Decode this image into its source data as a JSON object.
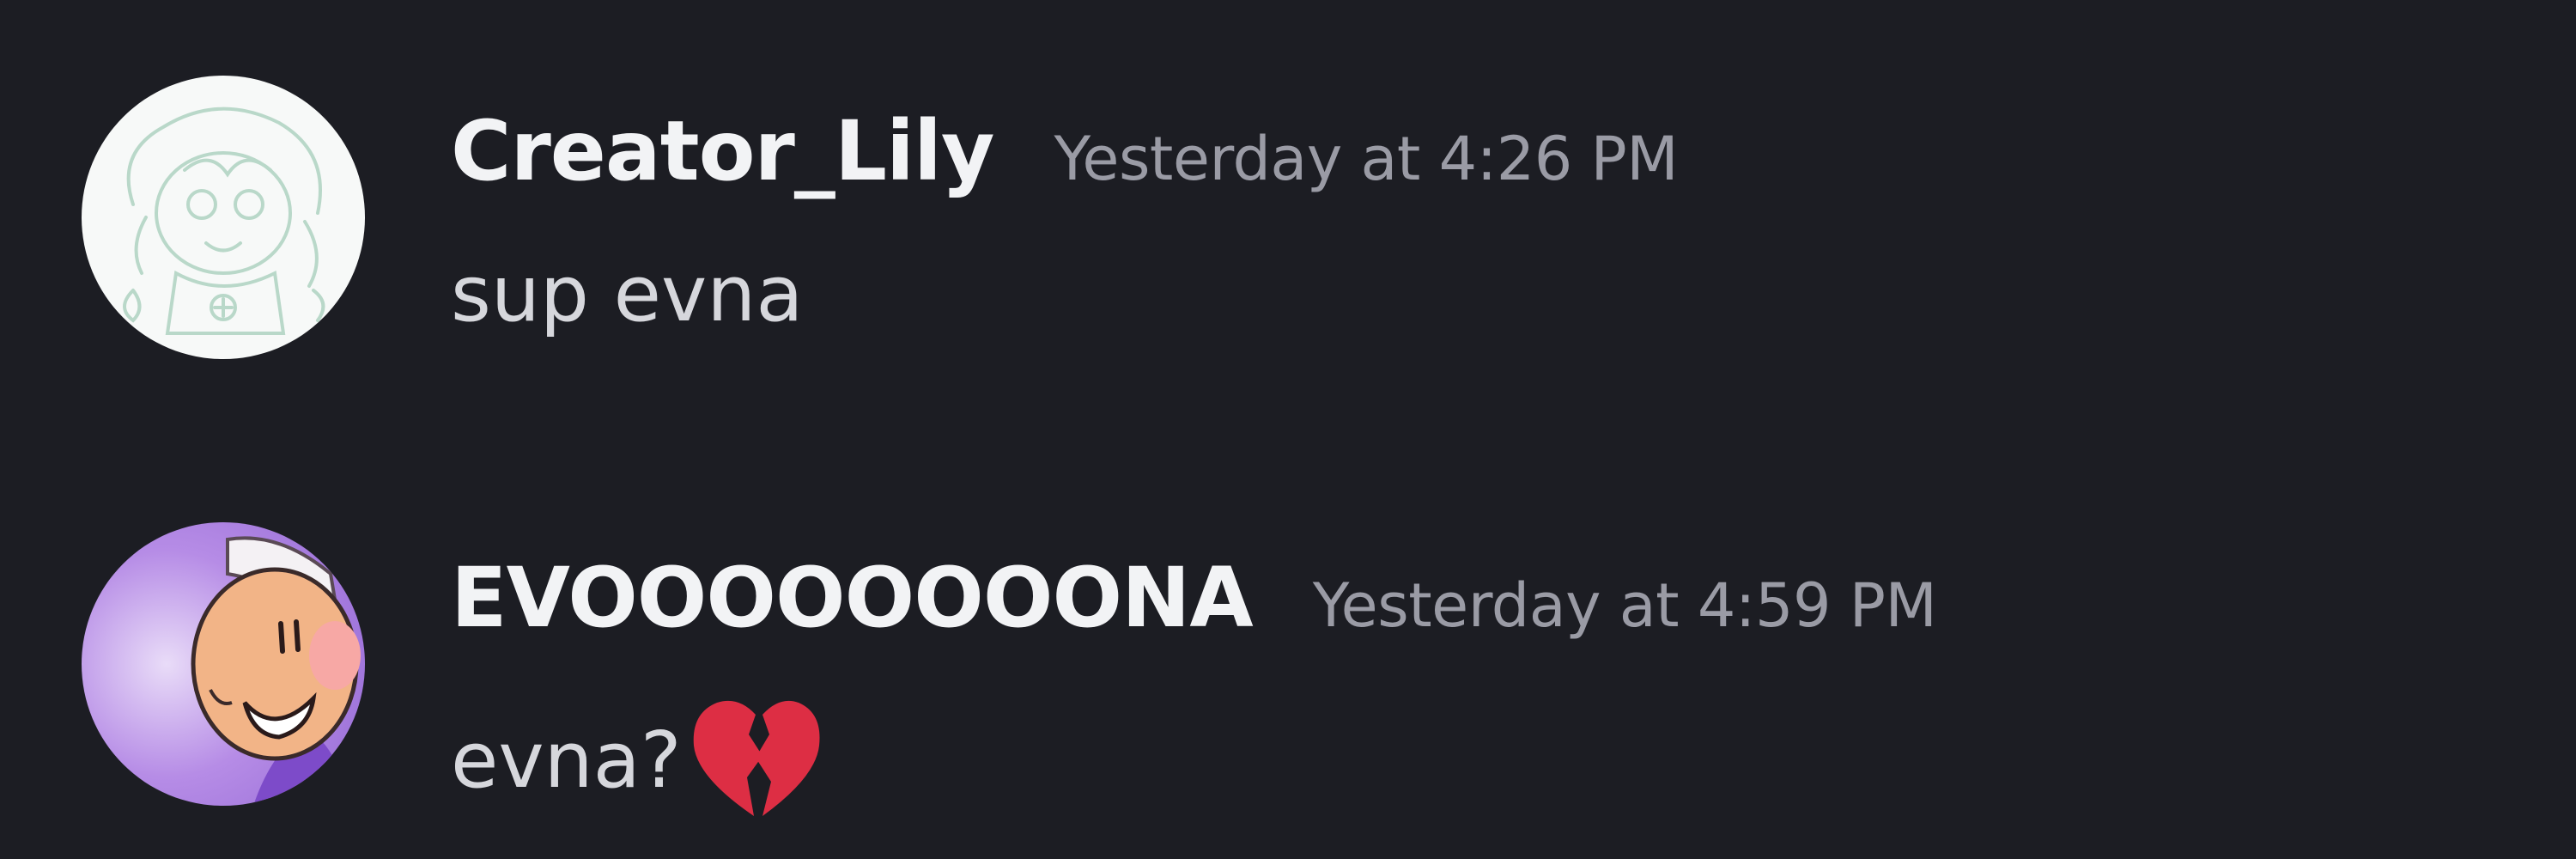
{
  "messages": [
    {
      "username": "Creator_Lily",
      "timestamp": "Yesterday at 4:26 PM",
      "text": "sup evna",
      "avatar_icon": "sketch-character-avatar"
    },
    {
      "username": "EVOOOOOOOONA",
      "timestamp": "Yesterday at 4:59 PM",
      "text": "evna?",
      "emoji": "broken-heart-emoji",
      "avatar_icon": "cartoon-character-avatar"
    }
  ],
  "colors": {
    "background": "#1c1d23",
    "username": "#f2f3f5",
    "timestamp": "#9a9ba5",
    "message_text": "#d6d7dc",
    "broken_heart": "#dd2e44"
  }
}
